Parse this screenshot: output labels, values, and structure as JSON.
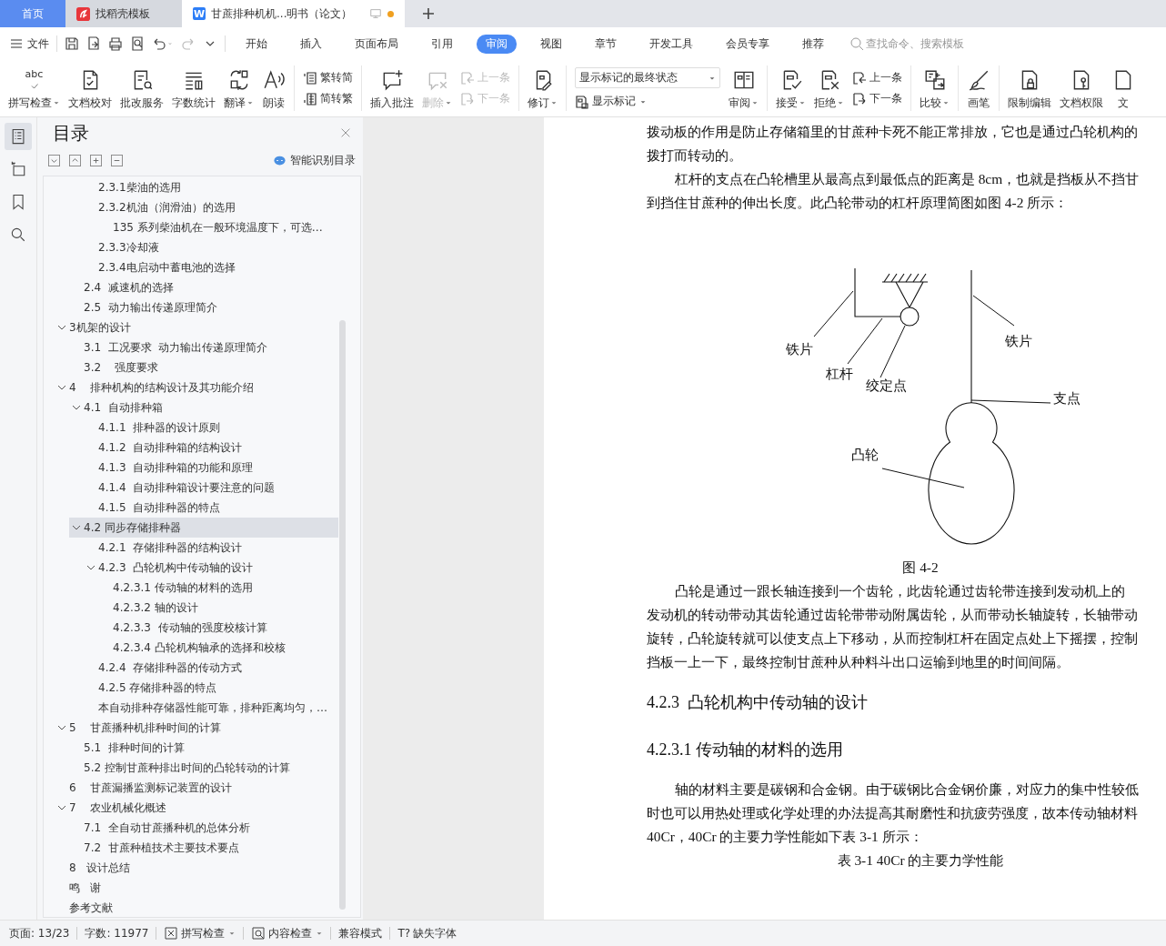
{
  "tabs": [
    {
      "kind": "home",
      "label": "首页",
      "selected": false
    },
    {
      "kind": "templates",
      "label": "找稻壳模板",
      "selected": false
    },
    {
      "kind": "document",
      "label": "甘蔗排种机机...明书（论文）",
      "glyph": "W",
      "selected": true,
      "unsaved": true
    }
  ],
  "menu": {
    "file": "文件",
    "tabs": [
      {
        "label": "开始",
        "selected": false
      },
      {
        "label": "插入",
        "selected": false
      },
      {
        "label": "页面布局",
        "selected": false
      },
      {
        "label": "引用",
        "selected": false
      },
      {
        "label": "审阅",
        "selected": true
      },
      {
        "label": "视图",
        "selected": false
      },
      {
        "label": "章节",
        "selected": false
      },
      {
        "label": "开发工具",
        "selected": false
      },
      {
        "label": "会员专享",
        "selected": false
      },
      {
        "label": "推荐",
        "selected": false
      }
    ],
    "search": {
      "placeholder": "查找命令、搜索模板"
    }
  },
  "ribbon": {
    "groups": [
      {
        "items": [
          {
            "kind": "spellcheck",
            "label": "拼写检查",
            "glyph": "abc",
            "dropdown": true,
            "disabled": false
          },
          {
            "kind": "proofread",
            "label": "文档校对",
            "dropdown": false,
            "disabled": false
          },
          {
            "kind": "service",
            "label": "批改服务",
            "dropdown": false,
            "disabled": false
          },
          {
            "kind": "wordcount",
            "label": "字数统计",
            "dropdown": false,
            "disabled": false
          },
          {
            "kind": "translate",
            "label": "翻译",
            "dropdown": true,
            "disabled": false
          },
          {
            "kind": "readaloud",
            "label": "朗读",
            "dropdown": false,
            "disabled": false
          }
        ]
      },
      {
        "items": [
          {
            "kind": "stack",
            "items": [
              {
                "kind": "trad",
                "label": "繁转简",
                "disabled": false
              },
              {
                "kind": "simp",
                "label": "简转繁",
                "disabled": false
              }
            ]
          }
        ]
      },
      {
        "items": [
          {
            "kind": "comment",
            "label": "插入批注",
            "dropdown": false,
            "disabled": false
          },
          {
            "kind": "delcomment",
            "label": "删除",
            "dropdown": true,
            "disabled": true
          },
          {
            "kind": "stack",
            "items": [
              {
                "kind": "prev",
                "label": "上一条",
                "disabled": true
              },
              {
                "kind": "next",
                "label": "下一条",
                "disabled": true
              }
            ]
          }
        ]
      },
      {
        "items": [
          {
            "kind": "track",
            "label": "修订",
            "dropdown": true,
            "disabled": false
          }
        ]
      },
      {
        "items": [
          {
            "kind": "markup",
            "select": "显示标记的最终状态",
            "label": "显示标记",
            "dropdown": true,
            "disabled": false
          },
          {
            "kind": "pane",
            "label": "审阅",
            "dropdown": true,
            "disabled": false
          }
        ]
      },
      {
        "items": [
          {
            "kind": "accept",
            "label": "接受",
            "dropdown": true,
            "disabled": false
          },
          {
            "kind": "reject",
            "label": "拒绝",
            "dropdown": true,
            "disabled": false
          },
          {
            "kind": "stack",
            "items": [
              {
                "kind": "prev",
                "label": "上一条",
                "disabled": false
              },
              {
                "kind": "next",
                "label": "下一条",
                "disabled": false
              }
            ]
          }
        ]
      },
      {
        "items": [
          {
            "kind": "compare",
            "label": "比较",
            "dropdown": true,
            "disabled": false
          }
        ]
      },
      {
        "items": [
          {
            "kind": "pen",
            "label": "画笔",
            "dropdown": false,
            "disabled": false
          }
        ]
      },
      {
        "items": [
          {
            "kind": "restrict",
            "label": "限制编辑",
            "dropdown": false,
            "disabled": false
          },
          {
            "kind": "permission",
            "label": "文档权限",
            "dropdown": false,
            "disabled": false
          },
          {
            "kind": "doc",
            "label": "文",
            "dropdown": false,
            "disabled": false
          }
        ]
      }
    ]
  },
  "rail": [
    {
      "kind": "toc",
      "selected": true
    },
    {
      "kind": "nav",
      "selected": false
    },
    {
      "kind": "bookmark",
      "selected": false
    },
    {
      "kind": "search",
      "selected": false
    }
  ],
  "toc": {
    "title": "目录",
    "smart_button": "智能识别目录",
    "items": [
      {
        "children": [
          {
            "children": [
              {
                "label": "2.3.1柴油的选用",
                "selected": false
              },
              {
                "label": "2.3.2机油（润滑油）的选用",
                "selected": false,
                "children": [
                  {
                    "label": "135 系列柴油机在一般环境温度下，可选…",
                    "selected": false
                  }
                ]
              },
              {
                "label": "2.3.3冷却液",
                "selected": false
              },
              {
                "label": "2.3.4电启动中蓄电池的选择",
                "selected": false
              }
            ]
          },
          {
            "label": "2.4  减速机的选择",
            "selected": false
          },
          {
            "label": "2.5  动力输出传递原理简介",
            "selected": false
          }
        ]
      },
      {
        "label": "3机架的设计",
        "expanded": true,
        "selected": false,
        "children": [
          {
            "label": "3.1  工况要求  动力输出传递原理简介",
            "selected": false
          },
          {
            "label": "3.2    强度要求",
            "selected": false
          }
        ]
      },
      {
        "label": "4    排种机构的结构设计及其功能介绍",
        "expanded": true,
        "selected": false,
        "children": [
          {
            "label": "4.1  自动排种箱",
            "expanded": true,
            "selected": false,
            "children": [
              {
                "label": "4.1.1  排种器的设计原则",
                "selected": false
              },
              {
                "label": "4.1.2  自动排种箱的结构设计",
                "selected": false
              },
              {
                "label": "4.1.3  自动排种箱的功能和原理",
                "selected": false
              },
              {
                "label": "4.1.4  自动排种箱设计要注意的问题",
                "selected": false
              },
              {
                "label": "4.1.5  自动排种器的特点",
                "selected": false
              }
            ]
          },
          {
            "label": "4.2 同步存储排种器",
            "expanded": true,
            "selected": true,
            "children": [
              {
                "label": "4.2.1  存储排种器的结构设计",
                "selected": false
              },
              {
                "label": "4.2.3  凸轮机构中传动轴的设计",
                "expanded": true,
                "selected": false,
                "children": [
                  {
                    "label": "4.2.3.1 传动轴的材料的选用",
                    "selected": false
                  },
                  {
                    "label": "4.2.3.2 轴的设计",
                    "selected": false
                  },
                  {
                    "label": "4.2.3.3  传动轴的强度校核计算",
                    "selected": false
                  },
                  {
                    "label": "4.2.3.4 凸轮机构轴承的选择和校核",
                    "selected": false
                  }
                ]
              },
              {
                "label": "4.2.4  存储排种器的传动方式",
                "selected": false
              },
              {
                "label": "4.2.5 存储排种器的特点",
                "selected": false
              },
              {
                "label": "本自动排种存储器性能可靠，排种距离均匀，…",
                "selected": false
              }
            ]
          }
        ]
      },
      {
        "label": "5    甘蔗播种机排种时间的计算",
        "expanded": true,
        "selected": false,
        "children": [
          {
            "label": "5.1  排种时间的计算",
            "selected": false
          },
          {
            "label": "5.2 控制甘蔗种排出时间的凸轮转动的计算",
            "selected": false
          }
        ]
      },
      {
        "label": "6    甘蔗漏播监测标记装置的设计",
        "selected": false
      },
      {
        "label": "7    农业机械化概述",
        "expanded": true,
        "selected": false,
        "children": [
          {
            "label": "7.1  全自动甘蔗播种机的总体分析",
            "selected": false
          },
          {
            "label": "7.2  甘蔗种植技术主要技术要点",
            "selected": false
          }
        ]
      },
      {
        "label": "8   设计总结",
        "selected": false
      },
      {
        "label": "鸣   谢",
        "selected": false
      },
      {
        "label": "参考文献",
        "selected": false
      }
    ]
  },
  "document": {
    "blocks": [
      {
        "kind": "continued",
        "lines": [
          "拨动板的作用是防止存储箱里的甘蔗种卡死不能正常排放，它也是通过凸轮机构的",
          "拨打而转动的。"
        ]
      },
      {
        "kind": "body",
        "lines": [
          "杠杆的支点在凸轮槽里从最高点到最低点的距离是 8cm，也就是挡板从不挡甘",
          "到挡住甘蔗种的伸出长度。此凸轮带动的杠杆原理简图如图 4-2 所示："
        ]
      },
      {
        "kind": "figure",
        "labels": [
          "铁片",
          "杠杆",
          "绞定点",
          "铁片",
          "支点",
          "凸轮"
        ]
      },
      {
        "kind": "caption",
        "text": "图 4-2"
      },
      {
        "kind": "body",
        "lines": [
          "凸轮是通过一跟长轴连接到一个齿轮，此齿轮通过齿轮带连接到发动机上的",
          "发动机的转动带动其齿轮通过齿轮带带动附属齿轮，从而带动长轴旋转，长轴带动",
          "旋转，凸轮旋转就可以使支点上下移动，从而控制杠杆在固定点处上下摇摆，控制",
          "挡板一上一下，最终控制甘蔗种从种料斗出口运输到地里的时间间隔。"
        ]
      },
      {
        "kind": "heading",
        "text": "4.2.3  凸轮机构中传动轴的设计"
      },
      {
        "kind": "heading",
        "text": "4.2.3.1 传动轴的材料的选用"
      },
      {
        "kind": "body",
        "lines": [
          "轴的材料主要是碳钢和合金钢。由于碳钢比合金钢价廉，对应力的集中性较低",
          "时也可以用热处理或化学处理的办法提高其耐磨性和抗疲劳强度，故本传动轴材料",
          "40Cr，40Cr 的主要力学性能如下表 3-1 所示："
        ]
      },
      {
        "kind": "caption",
        "text": "表 3-1 40Cr 的主要力学性能"
      }
    ]
  },
  "status_bar": [
    {
      "kind": "page",
      "label": "页面: 13/23"
    },
    {
      "kind": "words",
      "label": "字数: 11977"
    },
    {
      "kind": "spell",
      "label": "拼写检查",
      "dropdown": true
    },
    {
      "kind": "content",
      "label": "内容检查",
      "dropdown": true
    },
    {
      "kind": "compat",
      "label": "兼容模式"
    },
    {
      "kind": "font",
      "glyph": "T?",
      "label": "缺失字体"
    }
  ]
}
